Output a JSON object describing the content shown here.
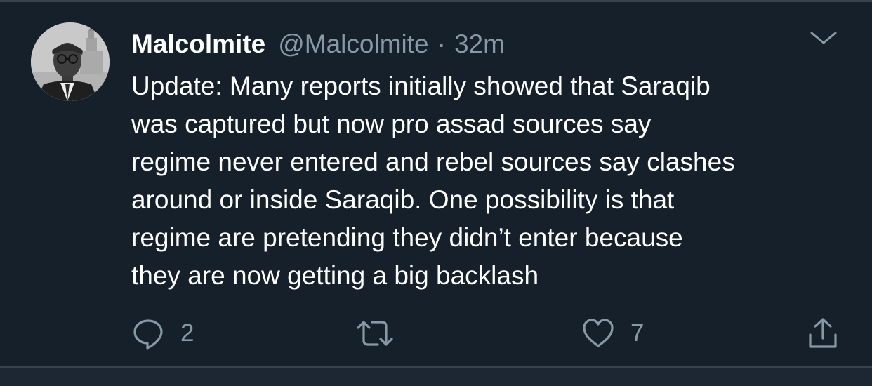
{
  "tweet": {
    "author_name": "Malcolmite",
    "author_handle": "@Malcolmite",
    "separator": "·",
    "time_ago": "32m",
    "text_lines": [
      "Update: Many reports initially showed that Saraqib",
      "was captured but now pro assad sources say",
      "regime never entered and rebel sources say clashes",
      "around or inside Saraqib. One possibility is that",
      "regime are pretending they didn’t enter because",
      "they are now getting a big backlash"
    ]
  },
  "actions": {
    "reply_count": "2",
    "retweet_count": "",
    "like_count": "7"
  },
  "icons": {
    "menu": "chevron-down-icon",
    "reply": "reply-icon",
    "retweet": "retweet-icon",
    "like": "heart-icon",
    "share": "share-icon"
  },
  "colors": {
    "background": "#15202b",
    "border": "#38444d",
    "primary_text": "#ffffff",
    "secondary_text": "#8899a6"
  }
}
